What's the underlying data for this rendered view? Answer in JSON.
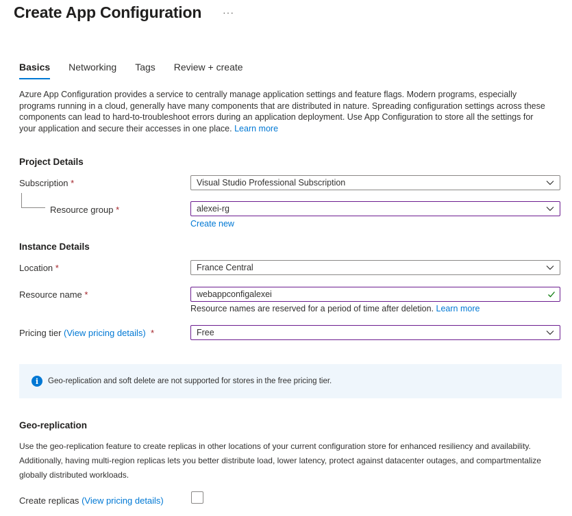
{
  "header": {
    "title": "Create App Configuration",
    "more": "···"
  },
  "tabs": [
    {
      "label": "Basics",
      "active": true
    },
    {
      "label": "Networking",
      "active": false
    },
    {
      "label": "Tags",
      "active": false
    },
    {
      "label": "Review + create",
      "active": false
    }
  ],
  "intro": {
    "text": "Azure App Configuration provides a service to centrally manage application settings and feature flags. Modern programs, especially programs running in a cloud, generally have many components that are distributed in nature. Spreading configuration settings across these components can lead to hard-to-troubleshoot errors during an application deployment. Use App Configuration to store all the settings for your application and secure their accesses in one place.",
    "link": "Learn more"
  },
  "project": {
    "heading": "Project Details",
    "subscription": {
      "label": "Subscription",
      "value": "Visual Studio Professional Subscription"
    },
    "resource_group": {
      "label": "Resource group",
      "value": "alexei-rg",
      "create_new": "Create new"
    }
  },
  "instance": {
    "heading": "Instance Details",
    "location": {
      "label": "Location",
      "value": "France Central"
    },
    "resource_name": {
      "label": "Resource name",
      "value": "webappconfigalexei",
      "hint": "Resource names are reserved for a period of time after deletion.",
      "hint_link": "Learn more"
    },
    "pricing": {
      "label": "Pricing tier",
      "link": "(View pricing details)",
      "value": "Free"
    }
  },
  "required_mark": "*",
  "info": {
    "text": "Geo-replication and soft delete are not supported for stores in the free pricing tier."
  },
  "geo": {
    "heading": "Geo-replication",
    "description": "Use the geo-replication feature to create replicas in other locations of your current configuration store for enhanced resiliency and availability. Additionally, having multi-region replicas lets you better distribute load, lower latency, protect against datacenter outages, and compartmentalize globally distributed workloads.",
    "create_replicas_label": "Create replicas",
    "create_replicas_link": "(View pricing details)",
    "create_replicas_checked": false
  },
  "colors": {
    "accent": "#0078d4",
    "required": "#a4262c",
    "focus_border": "#6b1b8f",
    "success": "#107c10",
    "info_bg": "#eff6fc"
  }
}
